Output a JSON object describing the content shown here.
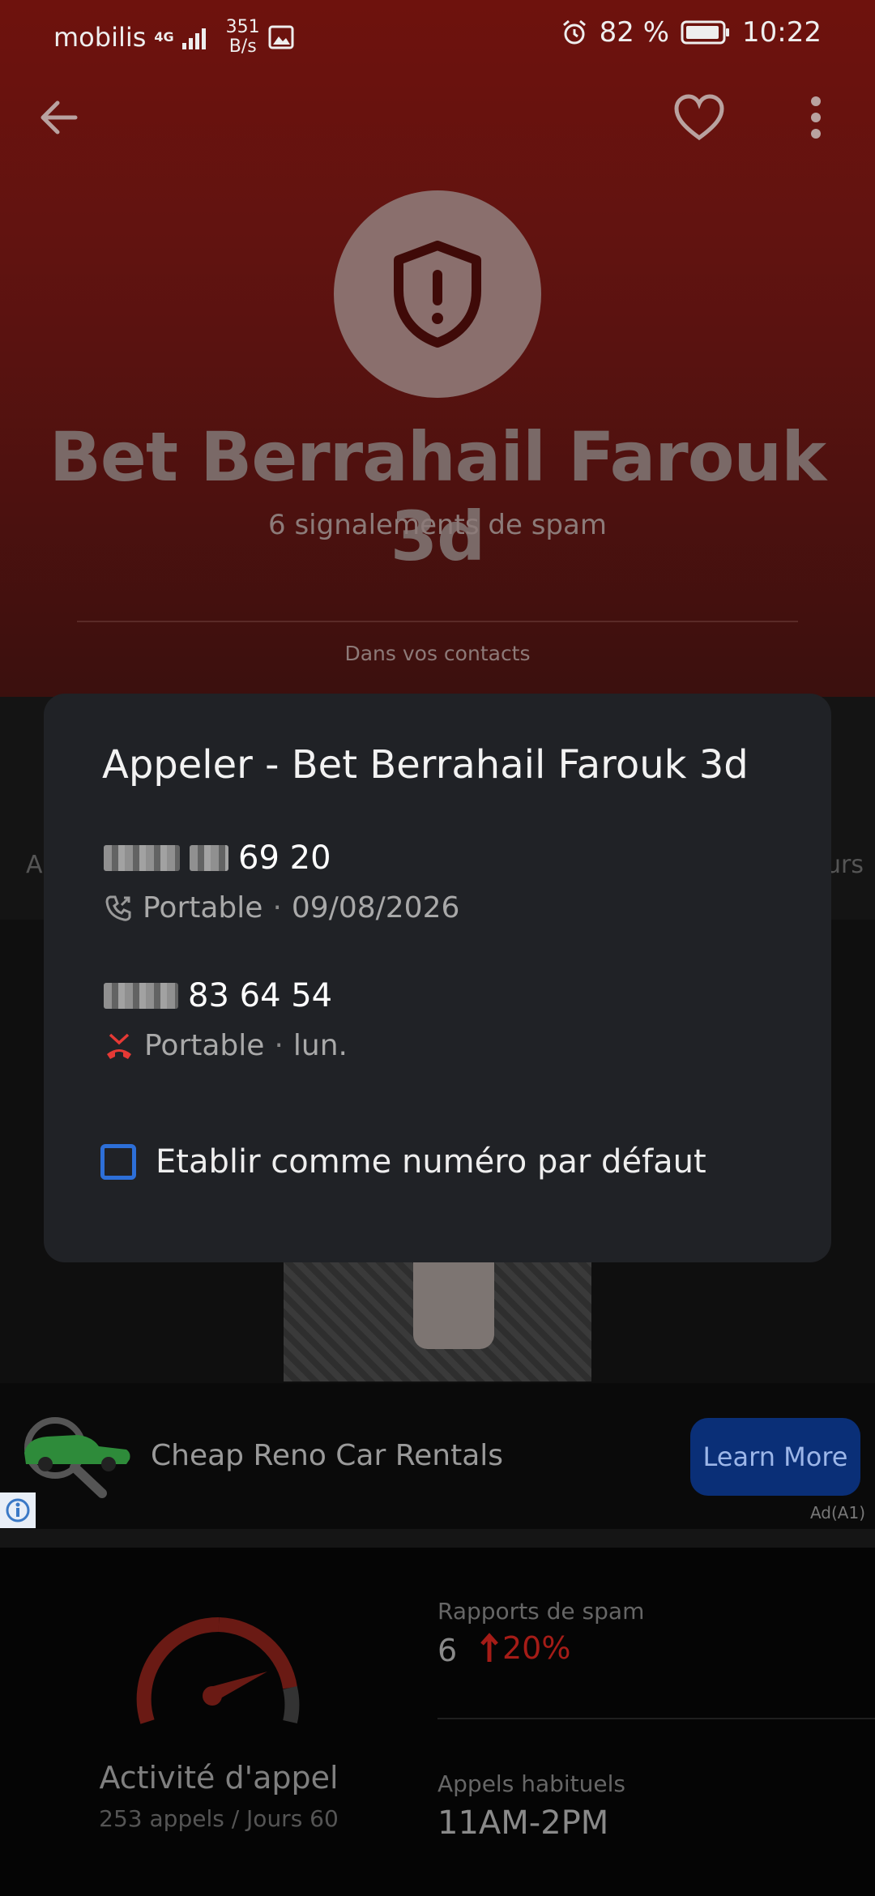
{
  "status_bar": {
    "carrier": "mobilis",
    "network_type": "4G",
    "net_speed_value": "351",
    "net_speed_unit": "B/s",
    "battery": "82 %",
    "time": "10:22"
  },
  "header": {
    "contact_name": "Bet Berrahail Farouk 3d",
    "spam_reports": "6 signalements de spam",
    "contacts_note": "Dans vos contacts"
  },
  "background_peek": {
    "left_text": "A",
    "right_text": "urs"
  },
  "dialog": {
    "title": "Appeler - Bet Berrahail Farouk 3d",
    "numbers": [
      {
        "number_visible": "69 20",
        "type": "Portable",
        "date": "09/08/2026",
        "icon": "call-outgoing-icon"
      },
      {
        "number_visible": "83 64 54",
        "type": "Portable",
        "date": "lun.",
        "icon": "call-missed-icon"
      }
    ],
    "default_checkbox_label": "Etablir comme numéro par défaut"
  },
  "ad": {
    "title": "Cheap Reno Car Rentals",
    "cta": "Learn More",
    "tag": "Ad(A1)"
  },
  "stats": {
    "activity_label": "Activité d'appel",
    "activity_sub": "253 appels / Jours 60",
    "spam_label": "Rapports de spam",
    "spam_value": "6",
    "spam_trend": "20%",
    "usual_calls_label": "Appels habituels",
    "usual_calls_value": "11AM-2PM"
  },
  "colors": {
    "accent_blue": "#2d6fd8",
    "missed_red": "#e53935",
    "header_red": "#6e120d"
  }
}
